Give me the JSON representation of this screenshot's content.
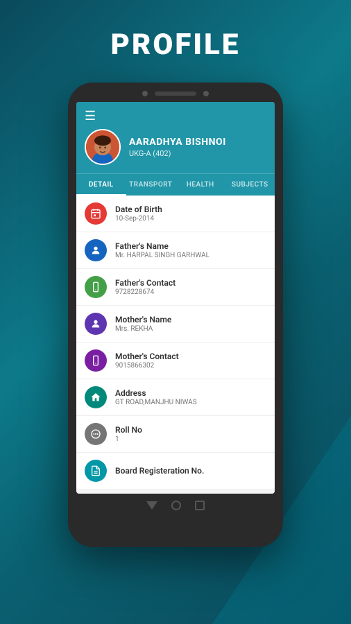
{
  "page": {
    "title": "PROFILE",
    "background_color": "#0a5566"
  },
  "student": {
    "name": "AARADHYA BISHNOI",
    "class": "UKG-A (402)"
  },
  "tabs": [
    {
      "id": "detail",
      "label": "DETAIL",
      "active": true
    },
    {
      "id": "transport",
      "label": "TRANSPORT",
      "active": false
    },
    {
      "id": "health",
      "label": "HEALTH",
      "active": false
    },
    {
      "id": "subjects",
      "label": "SUBJECTS",
      "active": false
    }
  ],
  "fields": [
    {
      "id": "dob",
      "label": "Date of Birth",
      "value": "10-Sep-2014",
      "icon_color": "red",
      "icon": "calendar"
    },
    {
      "id": "father_name",
      "label": "Father's Name",
      "value": "Mr. HARPAL SINGH GARHWAL",
      "icon_color": "blue",
      "icon": "person"
    },
    {
      "id": "father_contact",
      "label": "Father's Contact",
      "value": "9728228674",
      "icon_color": "green",
      "icon": "phone"
    },
    {
      "id": "mother_name",
      "label": "Mother's Name",
      "value": "Mrs. REKHA",
      "icon_color": "indigo",
      "icon": "person"
    },
    {
      "id": "mother_contact",
      "label": "Mother's Contact",
      "value": "9015866302",
      "icon_color": "purple",
      "icon": "phone"
    },
    {
      "id": "address",
      "label": "Address",
      "value": "GT ROAD,MANJHU NIWAS",
      "icon_color": "teal",
      "icon": "home"
    },
    {
      "id": "roll_no",
      "label": "Roll No",
      "value": "1",
      "icon_color": "gray",
      "icon": "number"
    },
    {
      "id": "board_reg",
      "label": "Board Registeration No.",
      "value": "",
      "icon_color": "cyan",
      "icon": "doc"
    }
  ],
  "hamburger_icon": "☰",
  "icons": {
    "calendar": "📅",
    "person": "👤",
    "phone": "📱",
    "home": "🏠",
    "number": "##",
    "doc": "📄"
  }
}
